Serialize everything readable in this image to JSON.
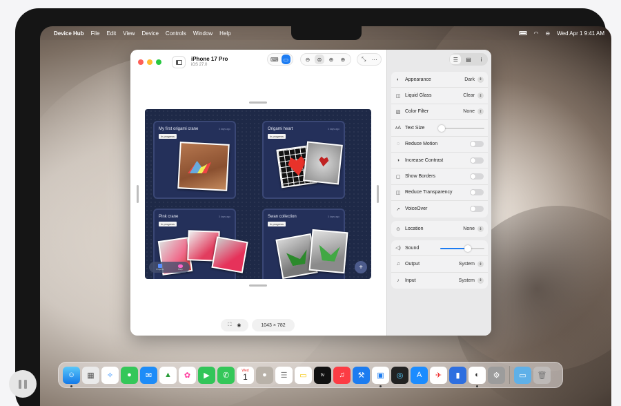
{
  "menubar": {
    "app_name": "Device Hub",
    "menus": [
      "File",
      "Edit",
      "View",
      "Device",
      "Controls",
      "Window",
      "Help"
    ],
    "datetime": "Wed Apr 1  9:41 AM"
  },
  "simulator": {
    "device_name": "iPhone 17 Pro",
    "os_version": "iOS 27.0",
    "resolution": "1043 × 782"
  },
  "app_screen": {
    "cards": [
      {
        "title": "My first origami crane",
        "ago": "3 days ago",
        "status": "In progress"
      },
      {
        "title": "Origami heart",
        "ago": "3 days ago",
        "status": "In progress"
      },
      {
        "title": "Pink crane",
        "ago": "3 days ago",
        "status": "In progress"
      },
      {
        "title": "Swan collection",
        "ago": "3 days ago",
        "status": "In progress"
      }
    ],
    "tabs": [
      {
        "label": "Projects"
      },
      {
        "label": "Shop"
      }
    ]
  },
  "settings": {
    "appearance": {
      "label": "Appearance",
      "value": "Dark"
    },
    "liquid_glass": {
      "label": "Liquid Glass",
      "value": "Clear"
    },
    "color_filter": {
      "label": "Color Filter",
      "value": "None"
    },
    "text_size": {
      "label": "Text Size",
      "level": 0.03
    },
    "reduce_motion": {
      "label": "Reduce Motion",
      "on": false
    },
    "increase_contrast": {
      "label": "Increase Contrast",
      "on": false
    },
    "show_borders": {
      "label": "Show Borders",
      "on": false
    },
    "reduce_transparency": {
      "label": "Reduce Transparency",
      "on": false
    },
    "voiceover": {
      "label": "VoiceOver",
      "on": false
    },
    "location": {
      "label": "Location",
      "value": "None"
    },
    "sound": {
      "label": "Sound",
      "level": 0.62
    },
    "output": {
      "label": "Output",
      "value": "System"
    },
    "input": {
      "label": "Input",
      "value": "System"
    }
  },
  "dock": {
    "calendar_month": "Wed",
    "calendar_day": "1",
    "tv_label": "tv"
  }
}
